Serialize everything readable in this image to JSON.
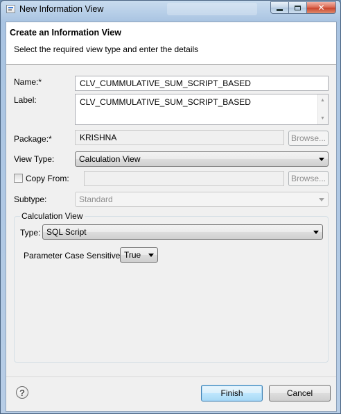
{
  "window": {
    "title": "New Information View"
  },
  "header": {
    "title": "Create an Information View",
    "description": "Select the required view type and enter the details"
  },
  "form": {
    "name": {
      "label": "Name:*",
      "value": "CLV_CUMMULATIVE_SUM_SCRIPT_BASED"
    },
    "label": {
      "label": "Label:",
      "value": "CLV_CUMMULATIVE_SUM_SCRIPT_BASED"
    },
    "package": {
      "label": "Package:*",
      "value": "KRISHNA",
      "browse_label": "Browse..."
    },
    "view_type": {
      "label": "View Type:",
      "value": "Calculation View"
    },
    "copy_from": {
      "label": "Copy From:",
      "value": "",
      "checked": false,
      "browse_label": "Browse..."
    },
    "subtype": {
      "label": "Subtype:",
      "value": "Standard"
    }
  },
  "calculation_view": {
    "group_title": "Calculation View",
    "type": {
      "label": "Type:",
      "value": "SQL Script"
    },
    "param_case_sensitive": {
      "label": "Parameter Case Sensitive:",
      "value": "True"
    }
  },
  "footer": {
    "help_glyph": "?",
    "finish_label": "Finish",
    "cancel_label": "Cancel"
  },
  "icons": {
    "close_glyph": "✕"
  }
}
